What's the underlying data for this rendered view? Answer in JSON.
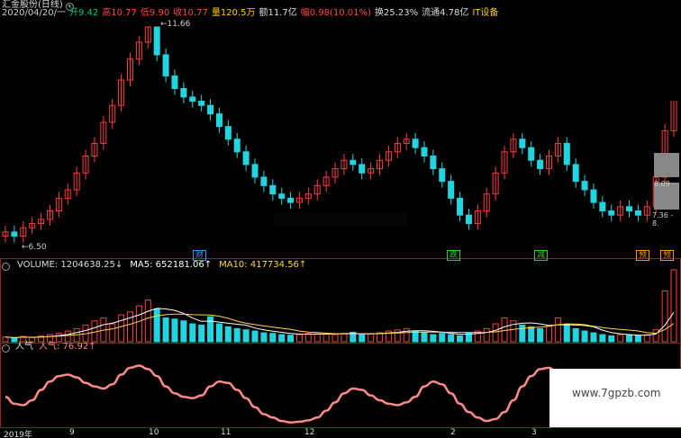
{
  "header": {
    "title": "汇金股份(日线)",
    "info_items": [
      {
        "label": "2020/04/20/一",
        "color": "#cccccc"
      },
      {
        "label": "开9.42",
        "color": "#00cc66"
      },
      {
        "label": "高10.77",
        "color": "#ff4444"
      },
      {
        "label": "低9.90",
        "color": "#ff4444"
      },
      {
        "label": "收10.77",
        "color": "#ff4444"
      },
      {
        "label": "量120.5万",
        "color": "#ffcc00"
      },
      {
        "label": "额11.7亿",
        "color": "#dddddd"
      },
      {
        "label": "幅0.98(10.01%)",
        "color": "#ff4444"
      },
      {
        "label": "换25.23%",
        "color": "#dddddd"
      },
      {
        "label": "流通4.78亿",
        "color": "#dddddd"
      },
      {
        "label": "IT设备",
        "color": "#ffcc00"
      }
    ]
  },
  "price_chart": {
    "high_label": "11.66",
    "low_label": "6.50",
    "right_label_1": "8.09 -",
    "right_label_2": "7.36 - 8.",
    "tags": [
      {
        "text": "财",
        "color": "#3399ff"
      },
      {
        "text": "跌",
        "color": "#33cc33"
      },
      {
        "text": "减",
        "color": "#33cc33"
      },
      {
        "text": "预",
        "color": "#ff9900"
      },
      {
        "text": "预",
        "color": "#ff9900"
      }
    ]
  },
  "volume_panel": {
    "label": "VOLUME: 1204638.25↓",
    "ma5": "MA5: 652181.06↑",
    "ma10": "MA10: 417734.56↑"
  },
  "indicator_panel": {
    "name": "人气",
    "value": "人气: 76.92↑"
  },
  "x_axis": {
    "labels": [
      "2019年",
      "9",
      "10",
      "11",
      "12",
      "2",
      "3"
    ]
  },
  "watermark": "www.7gpzb.com",
  "colors": {
    "up": "#ff3b3b",
    "down": "#21d5e0",
    "ma5": "#ffffff",
    "ma10": "#ffd54a",
    "indicator": "#ff8a8a",
    "frame": "#9a1f1f"
  },
  "chart_data": {
    "type": "candlestick",
    "y_range": [
      6.5,
      11.66
    ],
    "close_series_approx": [
      6.8,
      6.7,
      6.9,
      7.0,
      7.1,
      7.3,
      7.6,
      7.8,
      8.2,
      8.6,
      8.9,
      9.4,
      9.8,
      10.4,
      10.9,
      11.3,
      11.66,
      11.0,
      10.5,
      10.2,
      10.0,
      9.9,
      9.8,
      9.6,
      9.3,
      9.0,
      8.7,
      8.4,
      8.1,
      7.9,
      7.7,
      7.6,
      7.5,
      7.6,
      7.7,
      7.9,
      8.1,
      8.3,
      8.5,
      8.4,
      8.2,
      8.3,
      8.5,
      8.7,
      8.9,
      9.0,
      8.8,
      8.6,
      8.3,
      8.0,
      7.6,
      7.2,
      7.0,
      7.3,
      7.7,
      8.2,
      8.7,
      9.0,
      8.8,
      8.5,
      8.3,
      8.6,
      8.9,
      8.4,
      8.0,
      7.8,
      7.5,
      7.3,
      7.2,
      7.4,
      7.3,
      7.2,
      7.4,
      8.1,
      9.2,
      10.77
    ],
    "volume_series_approx": [
      8,
      6,
      9,
      7,
      10,
      12,
      14,
      18,
      22,
      28,
      35,
      40,
      30,
      45,
      50,
      60,
      70,
      55,
      40,
      38,
      35,
      30,
      28,
      42,
      30,
      25,
      22,
      20,
      18,
      15,
      14,
      12,
      11,
      12,
      14,
      15,
      13,
      12,
      14,
      16,
      12,
      13,
      15,
      18,
      20,
      22,
      18,
      15,
      12,
      14,
      12,
      10,
      15,
      18,
      22,
      30,
      40,
      35,
      28,
      25,
      22,
      26,
      40,
      30,
      22,
      18,
      15,
      12,
      10,
      12,
      11,
      10,
      12,
      20,
      85,
      120.5
    ],
    "indicator_series_approx": [
      40,
      30,
      28,
      35,
      50,
      62,
      70,
      72,
      68,
      60,
      55,
      52,
      58,
      72,
      82,
      85,
      80,
      70,
      55,
      45,
      40,
      38,
      42,
      55,
      62,
      60,
      50,
      38,
      25,
      15,
      10,
      5,
      3,
      4,
      6,
      10,
      20,
      32,
      45,
      52,
      50,
      42,
      35,
      30,
      28,
      32,
      40,
      55,
      62,
      58,
      45,
      30,
      18,
      10,
      5,
      8,
      18,
      35,
      55,
      70,
      80,
      82,
      72,
      55,
      38,
      25,
      18,
      20,
      24,
      22,
      18,
      15,
      18,
      30,
      55,
      76.92
    ]
  }
}
